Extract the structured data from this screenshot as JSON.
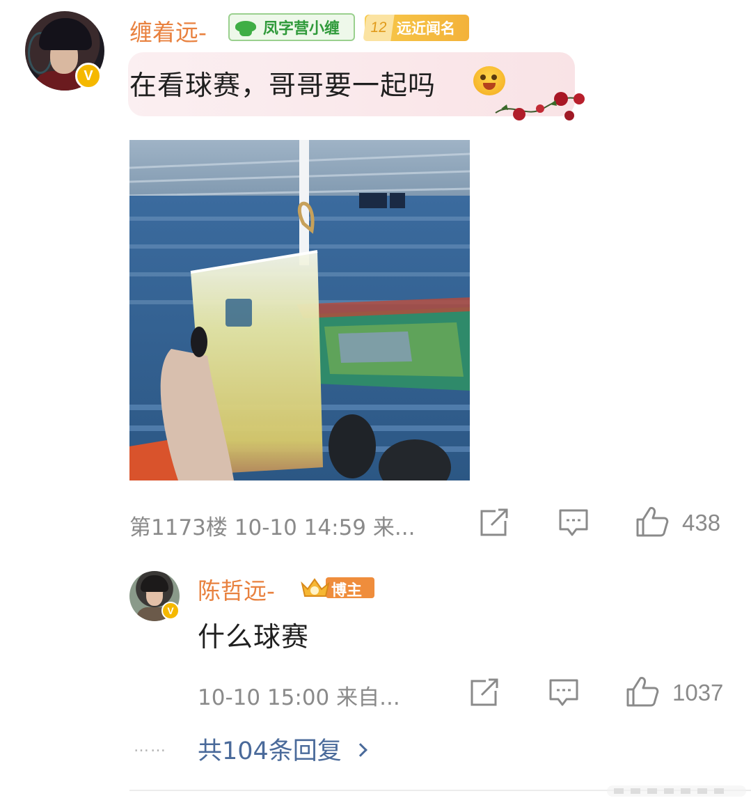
{
  "comment": {
    "username": "缠着远-",
    "fan_badge": "凤字营小缠",
    "level": "12",
    "level_badge": "远近闻名",
    "text": "在看球赛，哥哥要一起吗",
    "floor_meta": "第1173楼 10-10 14:59 来...",
    "like_count": "438"
  },
  "reply": {
    "username": "陈哲远-",
    "role_badge": "博主",
    "text": "什么球赛",
    "meta": "10-10 15:00 来自...",
    "like_count": "1037"
  },
  "more_replies": {
    "dots": "……",
    "label": "共104条回复"
  },
  "colors": {
    "username": "#e8813f",
    "meta": "#8a8a8a",
    "link": "#4a6a9a",
    "verified": "#f5b800"
  }
}
